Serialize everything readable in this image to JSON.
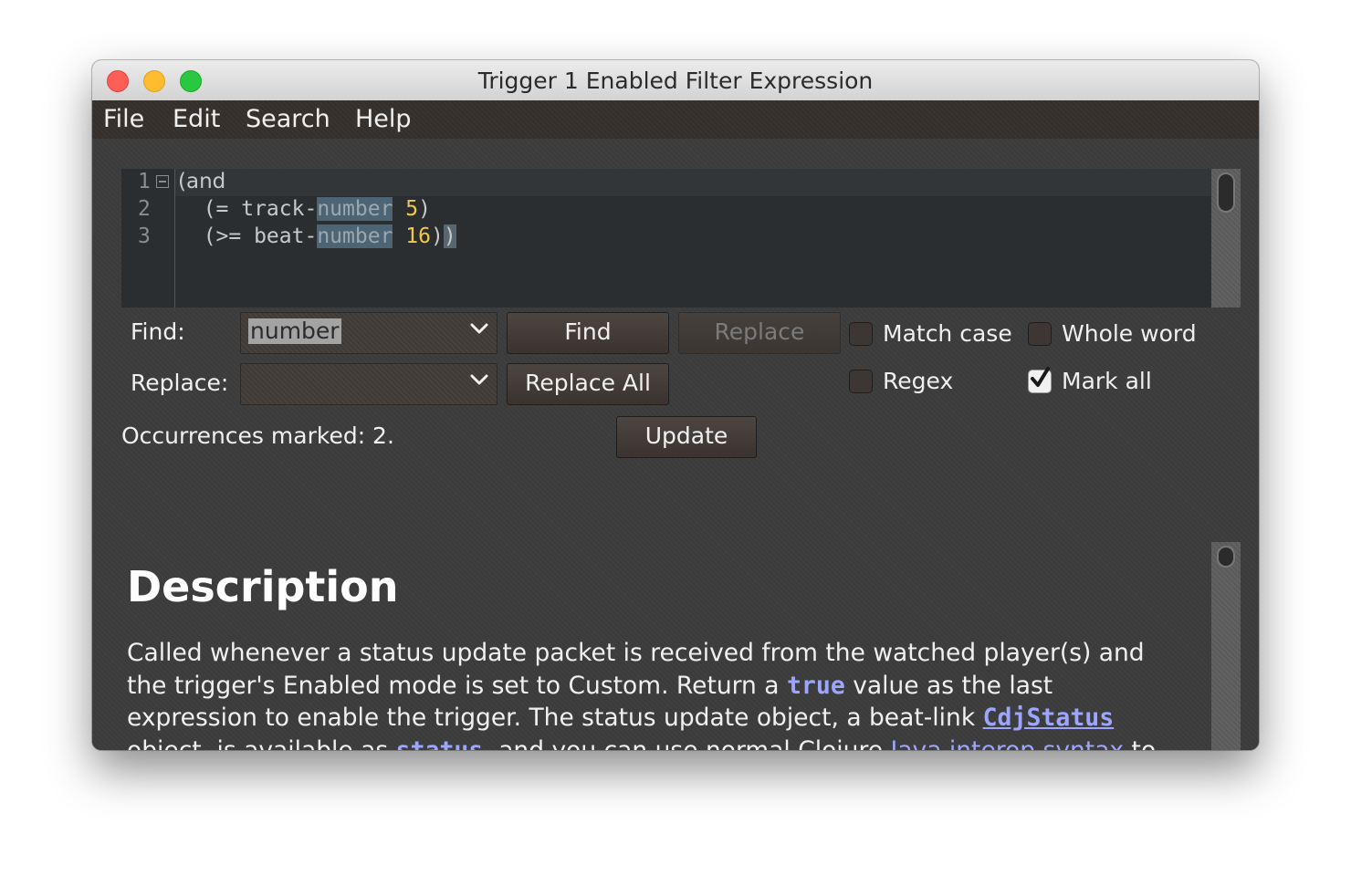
{
  "window": {
    "title": "Trigger 1 Enabled Filter Expression"
  },
  "menu": {
    "items": [
      "File",
      "Edit",
      "Search",
      "Help"
    ]
  },
  "editor": {
    "line_numbers": [
      "1",
      "2",
      "3"
    ],
    "lines": [
      {
        "open": "(and"
      },
      {
        "prefix": "  (= track-",
        "match": "number",
        "space": " ",
        "value": "5",
        "close": ")"
      },
      {
        "prefix": "  (>= beat-",
        "match": "number",
        "space": " ",
        "value": "16",
        "close": ")",
        "bracket": ")"
      }
    ]
  },
  "find_panel": {
    "find_label": "Find:",
    "find_value": "number",
    "replace_label": "Replace:",
    "replace_value": "",
    "find_button": "Find",
    "replace_button": "Replace",
    "replace_all_button": "Replace All",
    "match_case": {
      "label": "Match case",
      "checked": false
    },
    "whole_word": {
      "label": "Whole word",
      "checked": false
    },
    "regex": {
      "label": "Regex",
      "checked": false
    },
    "mark_all": {
      "label": "Mark all",
      "checked": true
    },
    "status": "Occurrences marked: 2.",
    "update_button": "Update"
  },
  "description": {
    "heading": "Description",
    "text1": "Called whenever a status update packet is received from the watched player(s) and the trigger's Enabled mode is set to Custom. Return a ",
    "kw_true": "true",
    "text2": " value as the last expression to enable the trigger. The status update object, a beat-link ",
    "link_cdj": "CdjStatus",
    "text3": " object, is available as ",
    "kw_status": "status",
    "text4": ", and you can use normal Clojure ",
    "link_interop": "Java interop syntax",
    "text5": " to access its fields and methods, but it is generally easier to use the convenience"
  }
}
